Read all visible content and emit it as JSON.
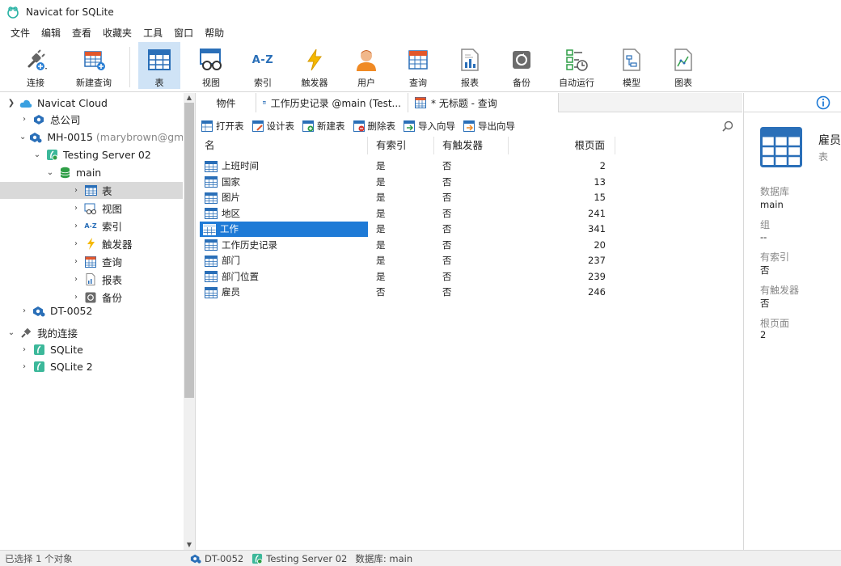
{
  "window": {
    "title": "Navicat for SQLite"
  },
  "menu": [
    "文件",
    "编辑",
    "查看",
    "收藏夹",
    "工具",
    "窗口",
    "帮助"
  ],
  "toolbar": {
    "connect": "连接",
    "new_query": "新建查询",
    "table": "表",
    "view": "视图",
    "index": "索引",
    "trigger": "触发器",
    "user": "用户",
    "query": "查询",
    "report": "报表",
    "backup": "备份",
    "automation": "自动运行",
    "model": "模型",
    "chart": "图表",
    "index_glyph": "A-Z"
  },
  "sidebar": {
    "cloud": "Navicat Cloud",
    "company": "总公司",
    "mh": "MH-0015",
    "mh_user": "(marybrown@gmai",
    "server": "Testing Server 02",
    "main": "main",
    "tables": "表",
    "views": "视图",
    "indexes": "索引",
    "triggers": "触发器",
    "queries": "查询",
    "reports": "报表",
    "backups": "备份",
    "dt": "DT-0052",
    "my_conn": "我的连接",
    "sqlite1": "SQLite",
    "sqlite2": "SQLite 2",
    "index_glyph": "A-Z"
  },
  "tabs": {
    "objects": "物件",
    "history": "工作历史记录 @main (Test...",
    "untitled": "* 无标题 - 查询"
  },
  "objbar": {
    "open": "打开表",
    "design": "设计表",
    "new": "新建表",
    "delete": "删除表",
    "import": "导入向导",
    "export": "导出向导"
  },
  "grid": {
    "headers": {
      "name": "名",
      "has_index": "有索引",
      "has_trigger": "有触发器",
      "root_page": "根页面"
    },
    "rows": [
      {
        "name": "上班时间",
        "idx": "是",
        "trg": "否",
        "page": "2"
      },
      {
        "name": "国家",
        "idx": "是",
        "trg": "否",
        "page": "13"
      },
      {
        "name": "图片",
        "idx": "是",
        "trg": "否",
        "page": "15"
      },
      {
        "name": "地区",
        "idx": "是",
        "trg": "否",
        "page": "241"
      },
      {
        "name": "工作",
        "idx": "是",
        "trg": "否",
        "page": "341"
      },
      {
        "name": "工作历史记录",
        "idx": "是",
        "trg": "否",
        "page": "20"
      },
      {
        "name": "部门",
        "idx": "是",
        "trg": "否",
        "page": "237"
      },
      {
        "name": "部门位置",
        "idx": "是",
        "trg": "否",
        "page": "239"
      },
      {
        "name": "雇员",
        "idx": "否",
        "trg": "否",
        "page": "246"
      }
    ]
  },
  "info": {
    "name": "雇员",
    "type": "表",
    "db_label": "数据库",
    "db_value": "main",
    "group_label": "组",
    "group_value": "--",
    "idx_label": "有索引",
    "idx_value": "否",
    "trg_label": "有触发器",
    "trg_value": "否",
    "page_label": "根页面",
    "page_value": "2"
  },
  "status": {
    "selection": "已选择 1 个对象",
    "connection": "DT-0052",
    "server": "Testing Server 02",
    "database": "数据库: main"
  },
  "colors": {
    "accent": "#1e7ad6",
    "table_icon": "#2a6fb8",
    "selected_tool": "#cfe3f6"
  }
}
